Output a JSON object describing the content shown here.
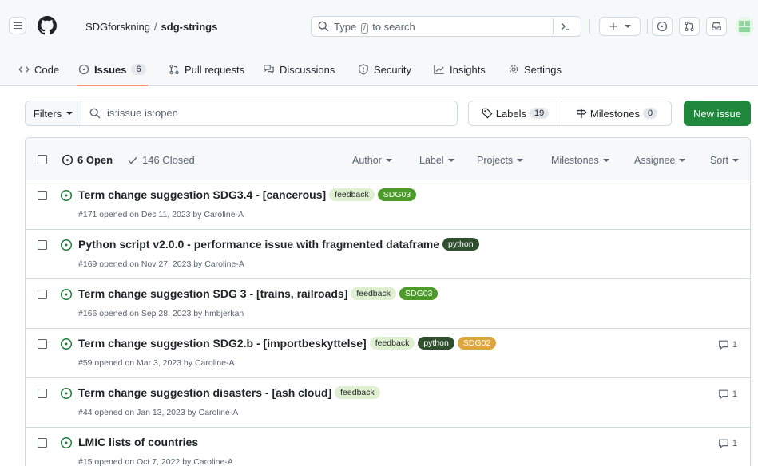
{
  "header": {
    "owner": "SDGforskning",
    "separator": "/",
    "repo": "sdg-strings",
    "search": {
      "prefix": "Type",
      "key": "/",
      "suffix": "to search"
    }
  },
  "tabs": [
    {
      "label": "Code",
      "icon": "code-icon"
    },
    {
      "label": "Issues",
      "count": "6",
      "icon": "issue-opened-icon",
      "selected": true
    },
    {
      "label": "Pull requests",
      "icon": "git-pull-request-icon"
    },
    {
      "label": "Discussions",
      "icon": "comment-discussion-icon"
    },
    {
      "label": "Security",
      "icon": "shield-icon"
    },
    {
      "label": "Insights",
      "icon": "graph-icon"
    },
    {
      "label": "Settings",
      "icon": "gear-icon"
    }
  ],
  "toolbar": {
    "filters_label": "Filters",
    "filter_query": "is:issue is:open",
    "labels_label": "Labels",
    "labels_count": "19",
    "milestones_label": "Milestones",
    "milestones_count": "0",
    "new_issue_label": "New issue"
  },
  "list_header": {
    "open_label": "6 Open",
    "closed_label": "146 Closed",
    "sort_items": [
      "Author",
      "Label",
      "Projects",
      "Milestones",
      "Assignee",
      "Sort"
    ]
  },
  "label_colors": {
    "feedback": {
      "bg": "#dff0d0",
      "fg": "#1f2328"
    },
    "SDG03": {
      "bg": "#4c9a2a",
      "fg": "#ffffff"
    },
    "python": {
      "bg": "#2f4f2f",
      "fg": "#ffffff"
    },
    "SDG02": {
      "bg": "#dda63a",
      "fg": "#ffffff"
    }
  },
  "issues": [
    {
      "title": "Term change suggestion SDG3.4 - [cancerous]",
      "labels": [
        "feedback",
        "SDG03"
      ],
      "meta": "#171 opened on Dec 11, 2023 by Caroline-A",
      "comments": ""
    },
    {
      "title": "Python script v2.0.0 - performance issue with fragmented dataframe",
      "labels": [
        "python"
      ],
      "meta": "#169 opened on Nov 27, 2023 by Caroline-A",
      "comments": ""
    },
    {
      "title": "Term change suggestion SDG 3 - [trains, railroads]",
      "labels": [
        "feedback",
        "SDG03"
      ],
      "meta": "#166 opened on Sep 28, 2023 by hmbjerkan",
      "comments": ""
    },
    {
      "title": "Term change suggestion SDG2.b - [importbeskyttelse]",
      "labels": [
        "feedback",
        "python",
        "SDG02"
      ],
      "meta": "#59 opened on Mar 3, 2023 by Caroline-A",
      "comments": "1"
    },
    {
      "title": "Term change suggestion disasters - [ash cloud]",
      "labels": [
        "feedback"
      ],
      "meta": "#44 opened on Jan 13, 2023 by Caroline-A",
      "comments": "1"
    },
    {
      "title": "LMIC lists of countries",
      "labels": [],
      "meta": "#15 opened on Oct 7, 2022 by Caroline-A",
      "comments": "1"
    }
  ]
}
